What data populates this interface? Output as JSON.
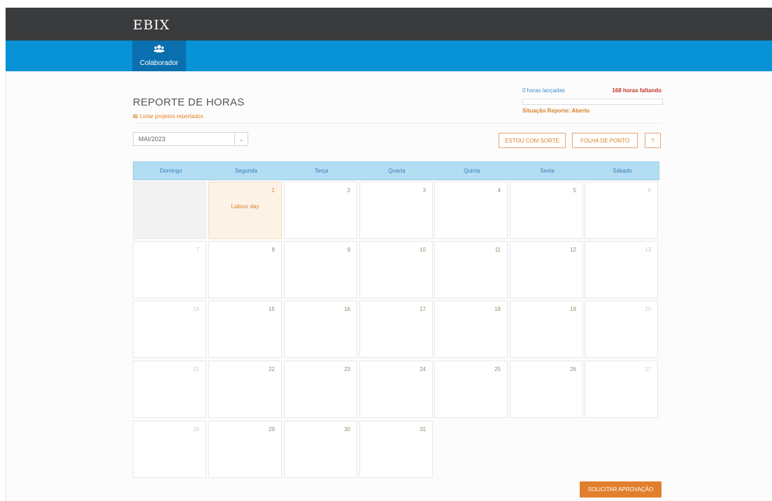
{
  "brand": {
    "logo_text": "EBIX"
  },
  "nav": {
    "tabs": [
      {
        "label": "Colaborador",
        "icon": "users-icon"
      }
    ]
  },
  "report": {
    "title": "REPORTE DE HORAS",
    "list_link": "Listar projetos reportados",
    "hours_logged": "0 horas lançadas",
    "hours_missing": "168 horas faltando",
    "progress_fraction": 0,
    "status": "Situação Reporte: Aberto"
  },
  "month_select": {
    "value": "MAI/2023"
  },
  "buttons": {
    "lucky": "ESTOU COM SORTE",
    "timesheet": "FOLHA DE PONTO",
    "help": "?",
    "submit": "SOLICITAR APROVAÇÃO"
  },
  "calendar": {
    "weekdays": [
      "Domingo",
      "Segunda",
      "Terça",
      "Quarta",
      "Quinta",
      "Sexta",
      "Sábado"
    ],
    "first_weekday_index": 1,
    "days_in_month": 31,
    "events": {
      "1": "Labour day"
    }
  },
  "colors": {
    "topbar": "#3a3b3d",
    "navbar": "#0793d6",
    "accent": "#e17f2d",
    "holiday_bg": "#fdf2e6",
    "header_bg": "#b3ddf2"
  }
}
